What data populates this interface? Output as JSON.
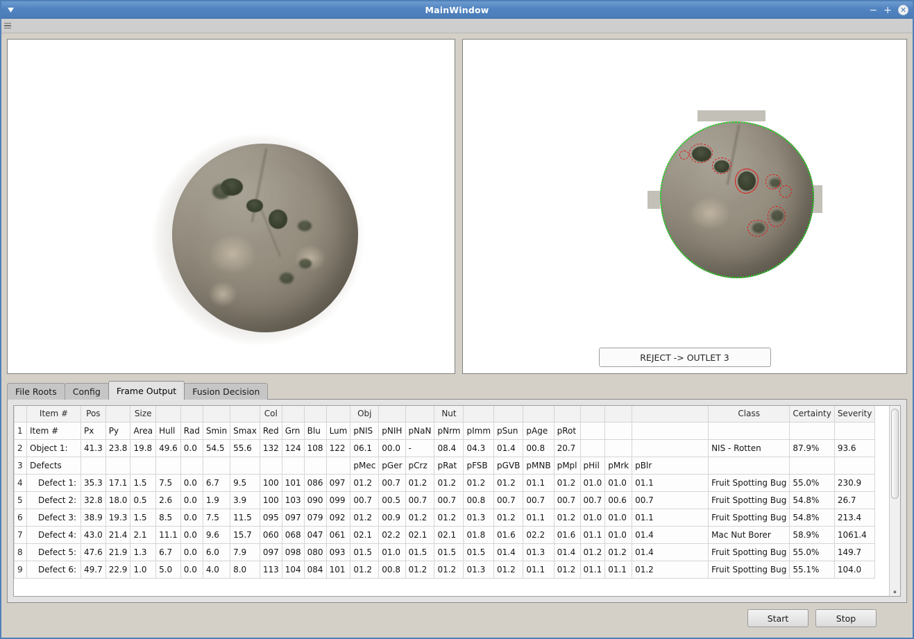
{
  "window": {
    "title": "MainWindow",
    "minimize_label": "−",
    "maximize_label": "+",
    "close_label": "✕"
  },
  "reject_button": {
    "label": "REJECT -> OUTLET 3"
  },
  "tabs": [
    {
      "label": "File Roots",
      "active": false
    },
    {
      "label": "Config",
      "active": false
    },
    {
      "label": "Frame Output",
      "active": true
    },
    {
      "label": "Fusion Decision",
      "active": false
    }
  ],
  "bottom_buttons": {
    "start": "Start",
    "stop": "Stop"
  },
  "table": {
    "group_headers": [
      "",
      "Item #",
      "Pos",
      "",
      "Size",
      "",
      "",
      "",
      "",
      "Col",
      "",
      "",
      "",
      "Obj",
      "",
      "",
      "Nut",
      "",
      "",
      "",
      "",
      "",
      "",
      "",
      "Class",
      "Certainty",
      "Severity"
    ],
    "rows": [
      {
        "num": "1",
        "label": "Item #",
        "indent": false,
        "cells": [
          "Px",
          "Py",
          "Area",
          "Hull",
          "Rad",
          "Smin",
          "Smax",
          "Red",
          "Grn",
          "Blu",
          "Lum",
          "pNIS",
          "pNIH",
          "pNaN",
          "pNrm",
          "pImm",
          "pSun",
          "pAge",
          "pRot",
          "",
          "",
          "",
          ""
        ],
        "class": "",
        "certainty": "",
        "severity": ""
      },
      {
        "num": "2",
        "label": "Object 1:",
        "indent": false,
        "cells": [
          "41.3",
          "23.8",
          "19.8",
          "49.6",
          "0.0",
          "54.5",
          "55.6",
          "132",
          "124",
          "108",
          "122",
          "06.1",
          "00.0",
          "-",
          "08.4",
          "04.3",
          "01.4",
          "00.8",
          "20.7",
          "",
          "",
          ""
        ],
        "class": "NIS - Rotten",
        "certainty": "87.9%",
        "severity": "93.6"
      },
      {
        "num": "3",
        "label": "Defects",
        "indent": false,
        "cells": [
          "",
          "",
          "",
          "",
          "",
          "",
          "",
          "",
          "",
          "",
          "",
          "pMec",
          "pGer",
          "pCrz",
          "pRat",
          "pFSB",
          "pGVB",
          "pMNB",
          "pMpl",
          "pHil",
          "pMrk",
          "pBlr"
        ],
        "class": "",
        "certainty": "",
        "severity": ""
      },
      {
        "num": "4",
        "label": "Defect 1:",
        "indent": true,
        "cells": [
          "35.3",
          "17.1",
          "1.5",
          "7.5",
          "0.0",
          "6.7",
          "9.5",
          "100",
          "101",
          "086",
          "097",
          "01.2",
          "00.7",
          "01.2",
          "01.2",
          "01.2",
          "01.2",
          "01.1",
          "01.2",
          "01.0",
          "01.0",
          "01.1"
        ],
        "class": "Fruit Spotting Bug",
        "certainty": "55.0%",
        "severity": "230.9"
      },
      {
        "num": "5",
        "label": "Defect 2:",
        "indent": true,
        "cells": [
          "32.8",
          "18.0",
          "0.5",
          "2.6",
          "0.0",
          "1.9",
          "3.9",
          "100",
          "103",
          "090",
          "099",
          "00.7",
          "00.5",
          "00.7",
          "00.7",
          "00.8",
          "00.7",
          "00.7",
          "00.7",
          "00.7",
          "00.6",
          "00.7"
        ],
        "class": "Fruit Spotting Bug",
        "certainty": "54.8%",
        "severity": "26.7"
      },
      {
        "num": "6",
        "label": "Defect 3:",
        "indent": true,
        "cells": [
          "38.9",
          "19.3",
          "1.5",
          "8.5",
          "0.0",
          "7.5",
          "11.5",
          "095",
          "097",
          "079",
          "092",
          "01.2",
          "00.9",
          "01.2",
          "01.2",
          "01.3",
          "01.2",
          "01.1",
          "01.2",
          "01.0",
          "01.0",
          "01.1"
        ],
        "class": "Fruit Spotting Bug",
        "certainty": "54.8%",
        "severity": "213.4"
      },
      {
        "num": "7",
        "label": "Defect 4:",
        "indent": true,
        "cells": [
          "43.0",
          "21.4",
          "2.1",
          "11.1",
          "0.0",
          "9.6",
          "15.7",
          "060",
          "068",
          "047",
          "061",
          "02.1",
          "02.2",
          "02.1",
          "02.1",
          "01.8",
          "01.6",
          "02.2",
          "01.6",
          "01.1",
          "01.0",
          "01.4"
        ],
        "class": "Mac Nut Borer",
        "certainty": "58.9%",
        "severity": "1061.4"
      },
      {
        "num": "8",
        "label": "Defect 5:",
        "indent": true,
        "cells": [
          "47.6",
          "21.9",
          "1.3",
          "6.7",
          "0.0",
          "6.0",
          "7.9",
          "097",
          "098",
          "080",
          "093",
          "01.5",
          "01.0",
          "01.5",
          "01.5",
          "01.5",
          "01.4",
          "01.3",
          "01.4",
          "01.2",
          "01.2",
          "01.4"
        ],
        "class": "Fruit Spotting Bug",
        "certainty": "55.0%",
        "severity": "149.7"
      },
      {
        "num": "9",
        "label": "Defect 6:",
        "indent": true,
        "cells": [
          "49.7",
          "22.9",
          "1.0",
          "5.0",
          "0.0",
          "4.0",
          "8.0",
          "113",
          "104",
          "084",
          "101",
          "01.2",
          "00.8",
          "01.2",
          "01.2",
          "01.3",
          "01.2",
          "01.1",
          "01.2",
          "01.1",
          "01.1",
          "01.2"
        ],
        "class": "Fruit Spotting Bug",
        "certainty": "55.1%",
        "severity": "104.0"
      }
    ],
    "trailing_headers": {
      "class": "Class",
      "certainty": "Certainty",
      "severity": "Severity"
    }
  },
  "colors": {
    "titlebar": "#5083c0",
    "accent_green": "#19e019",
    "accent_red": "#e01414",
    "window_bg": "#d4d0c8",
    "tab_active_bg": "#e3e3e3"
  }
}
